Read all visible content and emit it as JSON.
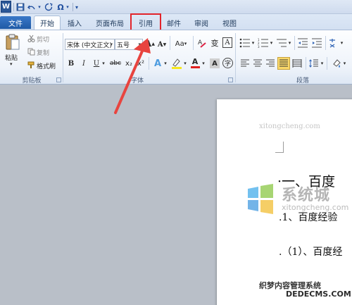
{
  "qat": {
    "logo": "W",
    "save_icon": "save-icon",
    "undo_icon": "undo-icon",
    "redo_icon": "redo-icon",
    "symbol": "Ω"
  },
  "tabs": [
    {
      "label": "文件"
    },
    {
      "label": "开始"
    },
    {
      "label": "插入"
    },
    {
      "label": "页面布局"
    },
    {
      "label": "引用"
    },
    {
      "label": "邮件"
    },
    {
      "label": "审阅"
    },
    {
      "label": "视图"
    }
  ],
  "clipboard": {
    "paste": "粘贴",
    "cut": "剪切",
    "copy": "复制",
    "format_painter": "格式刷",
    "group_label": "剪贴板"
  },
  "font": {
    "font_name": "宋体 (中文正文)",
    "font_size": "五号",
    "grow": "A",
    "shrink": "A",
    "case": "Aa",
    "wen": "变",
    "boxed": "A",
    "bold": "B",
    "italic": "I",
    "underline": "U",
    "strike": "abc",
    "sub": "x₂",
    "sup": "x²",
    "effects": "A",
    "highlight": "aby",
    "color": "A",
    "char_shade": "A",
    "enclose": "字",
    "group_label": "字体"
  },
  "paragraph": {
    "group_label": "段落"
  },
  "document": {
    "line1": "·一、百度",
    "line2": ".1、百度经验",
    "line3": ".（1）、百度经"
  },
  "watermark": {
    "site": "xitongcheng.com",
    "title": "系统城",
    "pinyin": "xitongcheng.com",
    "cn": "织梦内容管理系统",
    "dede": "DEDECMS.COM"
  },
  "colors": {
    "highlight_box": "#e2242b",
    "file_tab": "#2b65b3"
  }
}
